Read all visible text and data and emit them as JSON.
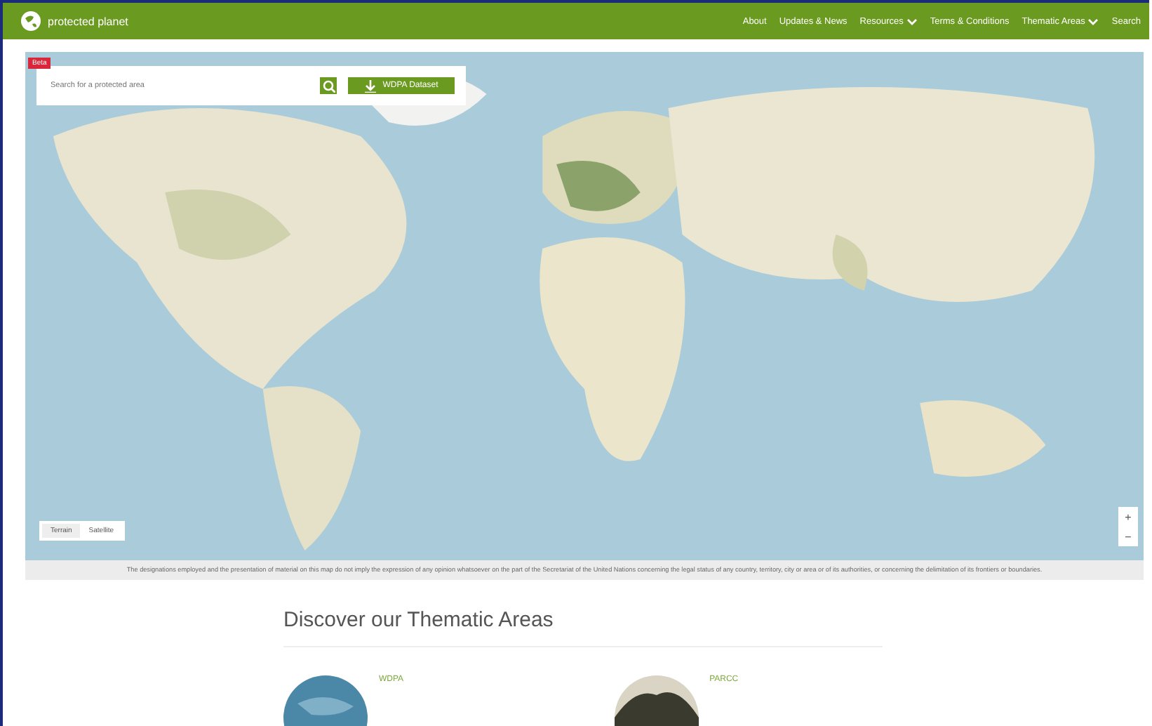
{
  "header": {
    "logo": "protected planet",
    "nav": [
      {
        "label": "About",
        "has_menu": false
      },
      {
        "label": "Updates & News",
        "has_menu": false
      },
      {
        "label": "Resources",
        "has_menu": true
      },
      {
        "label": "Terms & Conditions",
        "has_menu": false
      },
      {
        "label": "Thematic Areas",
        "has_menu": true
      },
      {
        "label": "Search",
        "has_menu": false
      }
    ]
  },
  "map": {
    "badge": "Beta",
    "search": {
      "placeholder": "Search for a protected area"
    },
    "dataset_button": "WDPA Dataset",
    "layers": [
      {
        "label": "Terrain",
        "selected": true
      },
      {
        "label": "Satellite",
        "selected": false
      }
    ],
    "zoom": [
      "+",
      "−"
    ]
  },
  "disclaimer": "The designations employed and the presentation of material on this map do not imply the expression of any opinion whatsoever on the part of the Secretariat of the United Nations concerning the legal status of any country, territory, city or area or of its authorities, or concerning the delimitation of its frontiers or boundaries.",
  "thematic": {
    "heading": "Discover our Thematic Areas",
    "cards": [
      {
        "title": "WDPA",
        "kind": "globe"
      },
      {
        "title": "PARCC",
        "kind": "trees"
      }
    ]
  }
}
